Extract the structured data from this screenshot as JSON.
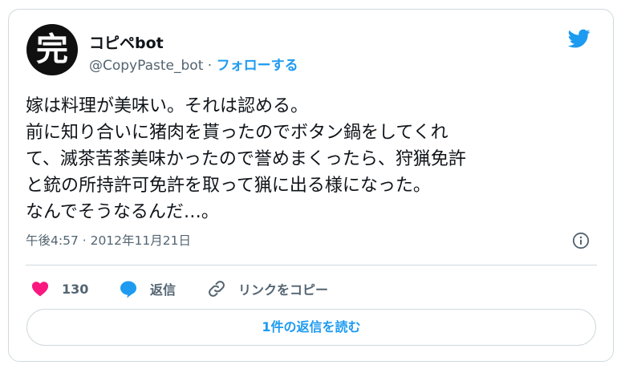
{
  "tweet": {
    "display_name": "コピペbot",
    "handle": "@CopyPaste_bot",
    "separator": "·",
    "follow_label": "フォローする",
    "avatar_char": "完",
    "body_lines": [
      "嫁は料理が美味い。それは認める。",
      "前に知り合いに猪肉を貰ったのでボタン鍋をしてくれ",
      "て、滅茶苦茶美味かったので誉めまくったら、狩猟免許",
      "と銃の所持許可免許を取って猟に出る様になった。",
      "なんでそうなるんだ…。"
    ],
    "timestamp": "午後4:57 · 2012年11月21日"
  },
  "actions": {
    "like_count": "130",
    "reply_label": "返信",
    "copy_link_label": "リンクをコピー"
  },
  "read_replies_label": "1件の返信を読む",
  "colors": {
    "accent": "#1d9bf0",
    "like": "#f91880",
    "secondary_text": "#536471",
    "border": "#cfd9de"
  },
  "icons": [
    "twitter-bird-icon",
    "info-icon",
    "heart-icon",
    "reply-bubble-icon",
    "link-icon"
  ]
}
